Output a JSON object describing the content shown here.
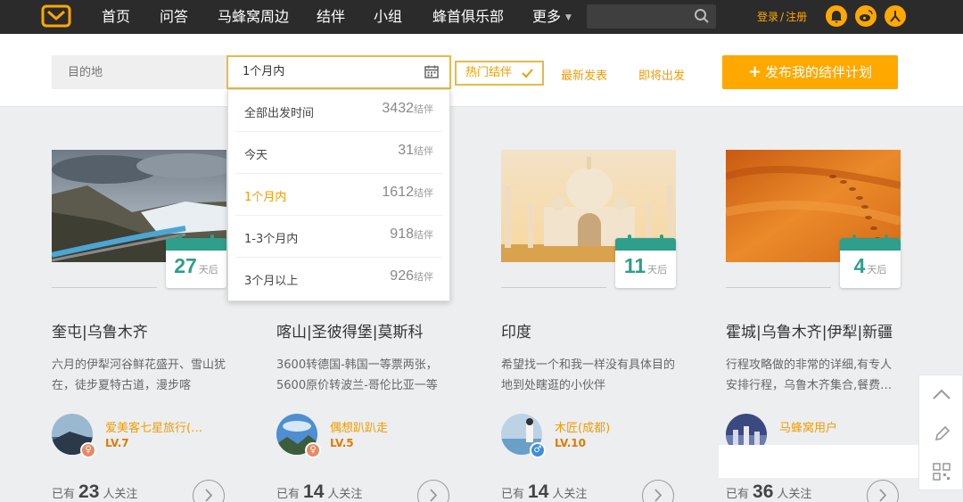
{
  "nav": {
    "items": [
      {
        "label": "首页"
      },
      {
        "label": "问答"
      },
      {
        "label": "马蜂窝周边"
      },
      {
        "label": "结伴"
      },
      {
        "label": "小组"
      },
      {
        "label": "蜂首俱乐部"
      },
      {
        "label": "更多"
      }
    ],
    "login": "登录",
    "slash": "/",
    "register": "注册",
    "social_icons": [
      "bell-icon",
      "weibo-icon",
      "user-icon"
    ]
  },
  "filter": {
    "destination_placeholder": "目的地",
    "date_value": "1个月内",
    "hot_label": "热门结伴",
    "newest_label": "最新发表",
    "upcoming_label": "即将出发",
    "publish_label": "发布我的结伴计划",
    "publish_plus": "+"
  },
  "dropdown": {
    "options": [
      {
        "label": "全部出发时间",
        "count": "3432",
        "unit": "结伴"
      },
      {
        "label": "今天",
        "count": "31",
        "unit": "结伴"
      },
      {
        "label": "1个月内",
        "count": "1612",
        "unit": "结伴"
      },
      {
        "label": "1-3个月内",
        "count": "918",
        "unit": "结伴"
      },
      {
        "label": "3个月以上",
        "count": "926",
        "unit": "结伴"
      }
    ],
    "selected_index": 2
  },
  "cards": [
    {
      "days": "27",
      "days_unit": "天后",
      "title": "奎屯|乌鲁木齐",
      "desc": "六月的伊犁河谷鲜花盛开、雪山犹在，徒步夏特古道，漫步喀",
      "username": "爱美客七星旅行(…",
      "level": "LV.7",
      "gender": "female",
      "follow_prefix": "已有",
      "follow_count": "23",
      "follow_suffix": "人关注"
    },
    {
      "days": "",
      "days_unit": "",
      "title": "喀山|圣彼得堡|莫斯科",
      "desc": "3600转德国-韩国一等票两张，5600原价转波兰-哥伦比亚一等",
      "username": "偶想趴趴走",
      "level": "LV.5",
      "gender": "female",
      "follow_prefix": "已有",
      "follow_count": "14",
      "follow_suffix": "人关注"
    },
    {
      "days": "11",
      "days_unit": "天后",
      "title": "印度",
      "desc": "希望找一个和我一样没有具体目的地到处瞎逛的小伙伴",
      "username": "木匠(成都)",
      "level": "LV.10",
      "gender": "male",
      "follow_prefix": "已有",
      "follow_count": "14",
      "follow_suffix": "人关注"
    },
    {
      "days": "4",
      "days_unit": "天后",
      "title": "霍城|乌鲁木齐|伊犁|新疆",
      "desc": "行程攻略做的非常的详细,有专人安排行程，乌鲁木齐集合,餐费…",
      "username": "马蜂窝用户",
      "level": "",
      "gender": "",
      "follow_prefix": "已有",
      "follow_count": "36",
      "follow_suffix": "人关注"
    }
  ],
  "colors": {
    "topbar": "#2b2b2b",
    "accent": "#ffa800",
    "teal": "#2e9f8a"
  }
}
